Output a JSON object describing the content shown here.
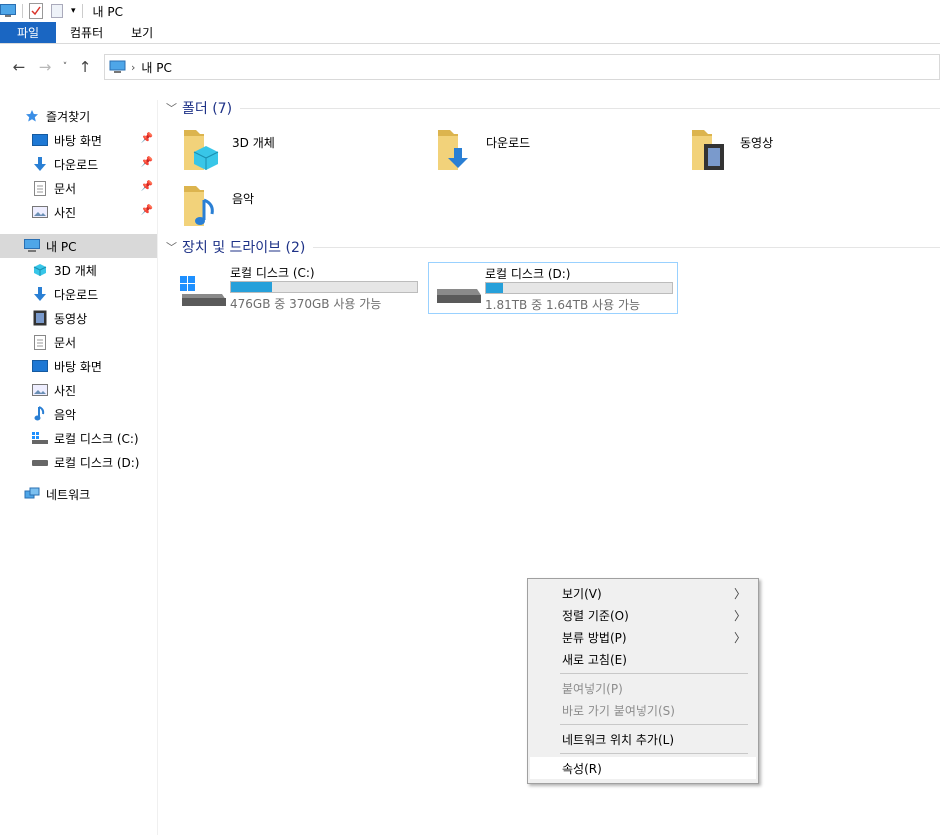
{
  "window": {
    "title": "내 PC"
  },
  "ribbon": {
    "tabs": [
      "파일",
      "컴퓨터",
      "보기"
    ]
  },
  "address": {
    "path": "내 PC"
  },
  "nav": {
    "quick_access": "즐겨찾기",
    "quick_items": [
      "바탕 화면",
      "다운로드",
      "문서",
      "사진"
    ],
    "this_pc": "내 PC",
    "pc_items": [
      "3D 개체",
      "다운로드",
      "동영상",
      "문서",
      "바탕 화면",
      "사진",
      "음악",
      "로컬 디스크 (C:)",
      "로컬 디스크 (D:)"
    ],
    "network": "네트워크"
  },
  "groups": {
    "folders_title": "폴더 (7)",
    "devices_title": "장치 및 드라이브 (2)"
  },
  "folders": [
    "3D 개체",
    "다운로드",
    "동영상",
    "음악"
  ],
  "drives": [
    {
      "name": "로컬 디스크 (C:)",
      "info": "476GB 중 370GB 사용 가능",
      "used_fraction": 0.22
    },
    {
      "name": "로컬 디스크 (D:)",
      "info": "1.81TB 중 1.64TB 사용 가능",
      "used_fraction": 0.09
    }
  ],
  "context_menu": {
    "items": [
      {
        "label": "보기(V)",
        "submenu": true,
        "disabled": false
      },
      {
        "label": "정렬 기준(O)",
        "submenu": true,
        "disabled": false
      },
      {
        "label": "분류 방법(P)",
        "submenu": true,
        "disabled": false
      },
      {
        "label": "새로 고침(E)",
        "submenu": false,
        "disabled": false
      },
      {
        "label": "붙여넣기(P)",
        "submenu": false,
        "disabled": true
      },
      {
        "label": "바로 가기 붙여넣기(S)",
        "submenu": false,
        "disabled": true
      },
      {
        "label": "네트워크 위치 추가(L)",
        "submenu": false,
        "disabled": false
      },
      {
        "label": "속성(R)",
        "submenu": false,
        "disabled": false
      }
    ]
  },
  "colors": {
    "accent": "#1a66c2",
    "drive_bar": "#26a0da",
    "group_title": "#1e3287"
  }
}
